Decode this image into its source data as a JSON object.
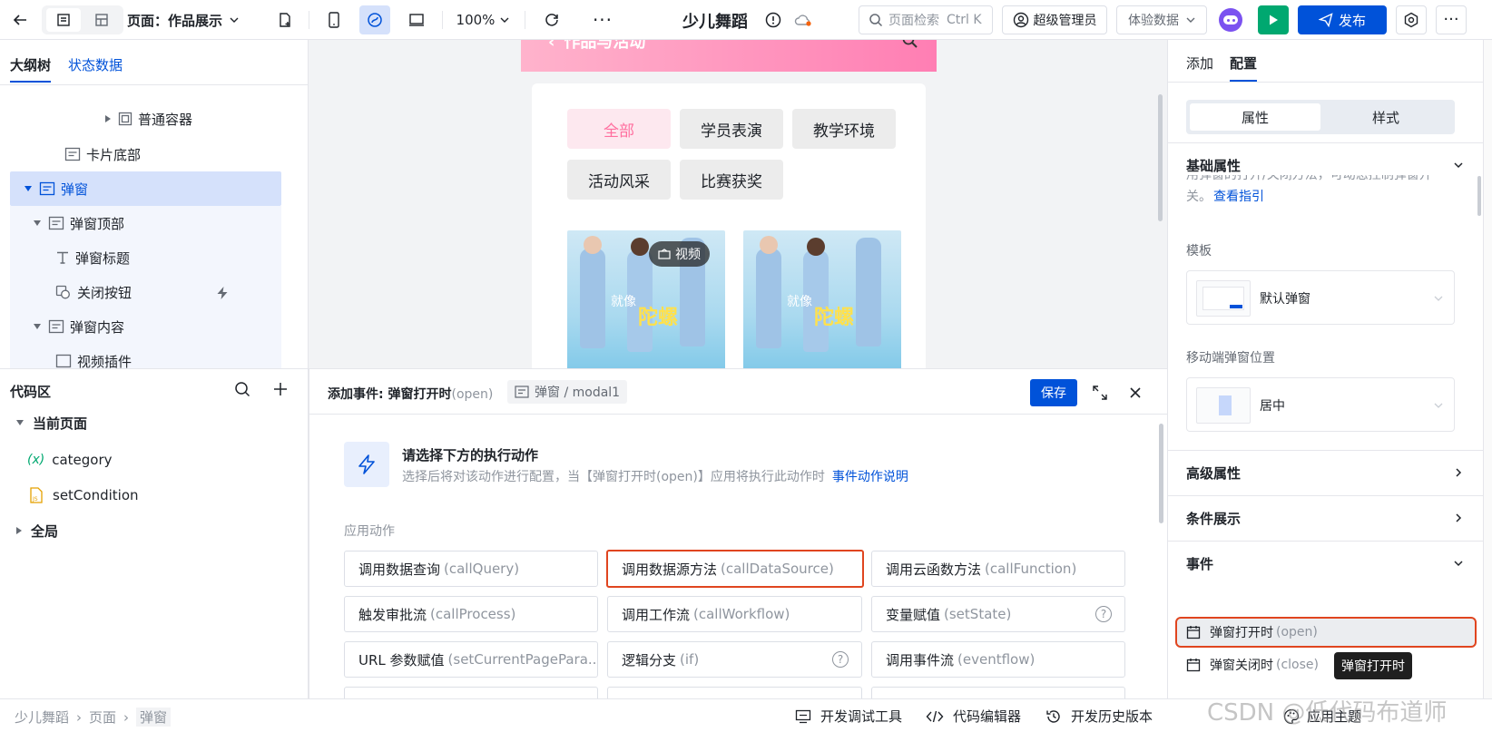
{
  "topbar": {
    "page_label": "页面：作品展示",
    "zoom": "100%",
    "app_title": "少儿舞蹈",
    "search_placeholder": "页面检索",
    "search_shortcut": "Ctrl K",
    "user": "超级管理员",
    "data_mode": "体验数据",
    "publish": "发布"
  },
  "left": {
    "tabs": [
      "大纲树",
      "状态数据"
    ],
    "tree": [
      "普通容器",
      "卡片底部",
      "弹窗",
      "弹窗顶部",
      "弹窗标题",
      "关闭按钮",
      "弹窗内容",
      "视频插件"
    ],
    "code_title": "代码区",
    "code_tree": {
      "current_page": "当前页面",
      "var_category": "category",
      "var_symbol": "(x)",
      "fn_setcondition": "setCondition",
      "global": "全局"
    }
  },
  "canvas": {
    "header_title": "作品与活动",
    "filters": [
      "全部",
      "学员表演",
      "教学环境",
      "活动风采",
      "比赛获奖"
    ],
    "video_badge": "视频",
    "thumb_text_1": "就像",
    "thumb_text_2": "陀螺"
  },
  "event": {
    "title_prefix": "添加事件: 弹窗打开时",
    "title_en": "(open)",
    "component_path": "弹窗 / modal1",
    "save": "保存",
    "prompt_title": "请选择下方的执行动作",
    "prompt_desc": "选择后将对该动作进行配置，当【弹窗打开时(open)】应用将执行此动作时",
    "prompt_link": "事件动作说明",
    "group_label": "应用动作",
    "actions": [
      {
        "cn": "调用数据查询",
        "en": "(callQuery)"
      },
      {
        "cn": "调用数据源方法",
        "en": "(callDataSource)"
      },
      {
        "cn": "调用云函数方法",
        "en": "(callFunction)"
      },
      {
        "cn": "触发审批流",
        "en": "(callProcess)"
      },
      {
        "cn": "调用工作流",
        "en": "(callWorkflow)"
      },
      {
        "cn": "变量赋值",
        "en": "(setState)"
      },
      {
        "cn": "URL 参数赋值",
        "en": "(setCurrentPagePara..."
      },
      {
        "cn": "逻辑分支",
        "en": "(if)"
      },
      {
        "cn": "调用事件流",
        "en": "(eventflow)"
      }
    ]
  },
  "right": {
    "tabs": [
      "添加",
      "配置"
    ],
    "seg": [
      "属性",
      "样式"
    ],
    "basic_props": "基础属性",
    "desc_text": "用弹窗的打开/关闭方法，可动态控制弹窗开关。",
    "desc_link": "查看指引",
    "template_label": "模板",
    "template_value": "默认弹窗",
    "position_label": "移动端弹窗位置",
    "position_value": "居中",
    "advanced": "高级属性",
    "condition": "条件展示",
    "events": "事件",
    "event_open_cn": "弹窗打开时",
    "event_open_en": "(open)",
    "event_close_cn": "弹窗关闭时",
    "event_close_en": "(close)",
    "tooltip": "弹窗打开时"
  },
  "bottom": {
    "breadcrumb": [
      "少儿舞蹈",
      "页面",
      "弹窗"
    ],
    "debug_tool": "开发调试工具",
    "code_editor": "代码编辑器",
    "history": "开发历史版本",
    "theme": "应用主题",
    "watermark": "CSDN @低代码布道师"
  },
  "colors": {
    "primary": "#0052d9",
    "green": "#00a870",
    "highlight_border": "#e0451f",
    "selected_row": "#d5e1fb",
    "pink": "#ff7eb3"
  }
}
